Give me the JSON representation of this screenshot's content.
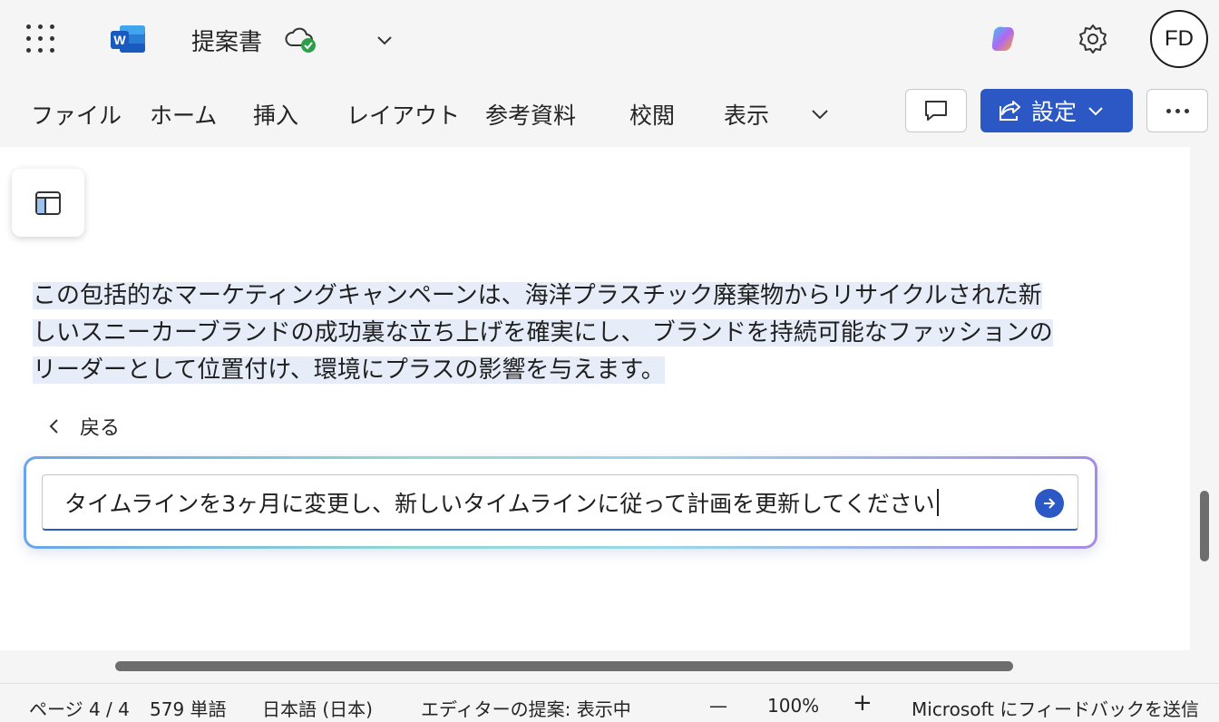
{
  "titlebar": {
    "doc_title": "提案書",
    "avatar_initials": "FD",
    "icons": [
      "waffle-icon",
      "word-logo-icon",
      "cloud-saved-icon",
      "chevron-down-icon",
      "copilot-icon",
      "gear-icon"
    ],
    "brand_color": "#2b58c4"
  },
  "ribbon": {
    "tabs": [
      "ファイル",
      "ホーム",
      "挿入",
      "レイアウト",
      "参考資料",
      "校閲",
      "表示"
    ],
    "settings_label": "設定"
  },
  "document": {
    "paragraph_lines": [
      "この包括的なマーケティングキャンペーンは、海洋プラスチック廃棄物からリサイクルされた新",
      "しいスニーカーブランドの成功裏な立ち上げを確実にし、 ブランドを持続可能なファッションの",
      "リーダーとして位置付け、環境にプラスの影響を与えます。"
    ],
    "highlight_color": "#e6edf8",
    "back_label": "戻る"
  },
  "prompt": {
    "text": "タイムラインを3ヶ月に変更し、新しいタイムラインに従って計画を更新してください"
  },
  "statusbar": {
    "page": "ページ 4 / 4",
    "words": "579 単語",
    "language": "日本語 (日本)",
    "editor": "エディターの提案: 表示中",
    "zoom_out": "—",
    "zoom": "100%",
    "zoom_in": "+",
    "feedback": "Microsoft にフィードバックを送信"
  }
}
